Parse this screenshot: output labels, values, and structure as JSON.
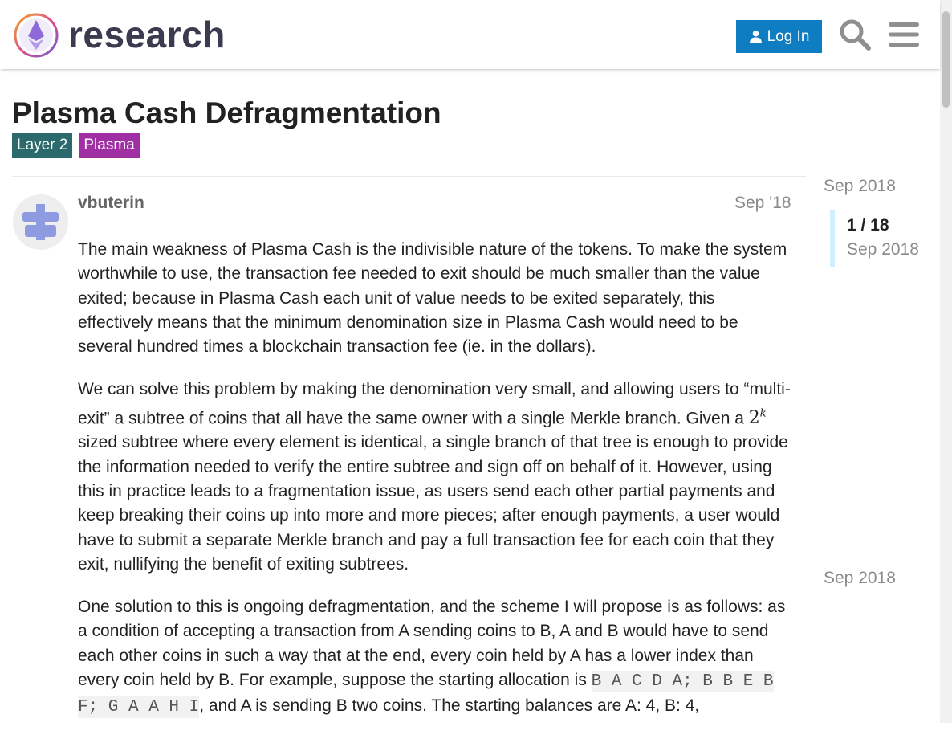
{
  "header": {
    "logo_text": "research",
    "login_label": "Log In",
    "icons": [
      "logo-icon",
      "user-icon",
      "search-icon",
      "menu-icon"
    ]
  },
  "topic": {
    "title": "Plasma Cash Defragmentation",
    "tags": [
      {
        "label": "Layer 2",
        "color": "#2a6a6c"
      },
      {
        "label": "Plasma",
        "color": "#9f2fa3"
      }
    ]
  },
  "post": {
    "username": "vbuterin",
    "date": "Sep '18",
    "p1": "The main weakness of Plasma Cash is the indivisible nature of the tokens. To make the system worthwhile to use, the transaction fee needed to exit should be much smaller than the value exited; because in Plasma Cash each unit of value needs to be exited separately, this effectively means that the minimum denomination size in Plasma Cash would need to be several hundred times a blockchain transaction fee (ie. in the dollars).",
    "p2_a": "We can solve this problem by making the denomination very small, and allowing users to “multi-exit” a subtree of coins that all have the same owner with a single Merkle branch. Given a ",
    "p2_math_base": "2",
    "p2_math_exp": "k",
    "p2_b": " sized subtree where every element is identical, a single branch of that tree is enough to provide the information needed to verify the entire subtree and sign off on behalf of it. However, using this in practice leads to a fragmentation issue, as users send each other partial payments and keep breaking their coins up into more and more pieces; after enough payments, a user would have to submit a separate Merkle branch and pay a full transaction fee for each coin that they exit, nullifying the benefit of exiting subtrees.",
    "p3_a": "One solution to this is ongoing defragmentation, and the scheme I will propose is as follows: as a condition of accepting a transaction from A sending coins to B, A and B would have to send each other coins in such a way that at the end, every coin held by A has a lower index than every coin held by B. For example, suppose the starting allocation is ",
    "p3_code": "B A C D A; B B E B F; G A A H I",
    "p3_b": ", and A is sending B two coins. The starting balances are A: 4, B: 4,"
  },
  "timeline": {
    "top_date": "Sep 2018",
    "position": "1 / 18",
    "current_date": "Sep 2018",
    "bottom_date": "Sep 2018"
  },
  "colors": {
    "accent": "#0f7dc2",
    "timeline_handle": "#d1f0ff"
  }
}
